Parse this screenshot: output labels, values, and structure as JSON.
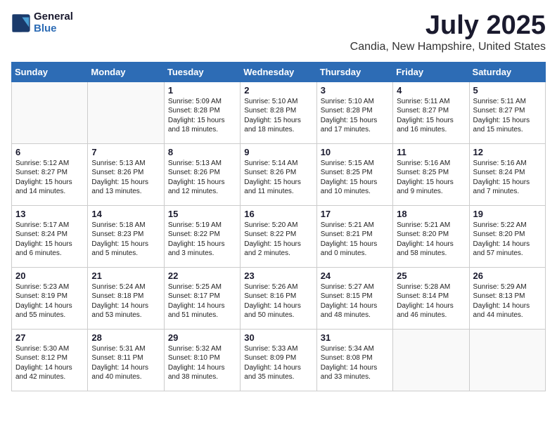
{
  "header": {
    "logo_line1": "General",
    "logo_line2": "Blue",
    "month": "July 2025",
    "location": "Candia, New Hampshire, United States"
  },
  "days_of_week": [
    "Sunday",
    "Monday",
    "Tuesday",
    "Wednesday",
    "Thursday",
    "Friday",
    "Saturday"
  ],
  "weeks": [
    [
      {
        "day": "",
        "info": ""
      },
      {
        "day": "",
        "info": ""
      },
      {
        "day": "1",
        "info": "Sunrise: 5:09 AM\nSunset: 8:28 PM\nDaylight: 15 hours\nand 18 minutes."
      },
      {
        "day": "2",
        "info": "Sunrise: 5:10 AM\nSunset: 8:28 PM\nDaylight: 15 hours\nand 18 minutes."
      },
      {
        "day": "3",
        "info": "Sunrise: 5:10 AM\nSunset: 8:28 PM\nDaylight: 15 hours\nand 17 minutes."
      },
      {
        "day": "4",
        "info": "Sunrise: 5:11 AM\nSunset: 8:27 PM\nDaylight: 15 hours\nand 16 minutes."
      },
      {
        "day": "5",
        "info": "Sunrise: 5:11 AM\nSunset: 8:27 PM\nDaylight: 15 hours\nand 15 minutes."
      }
    ],
    [
      {
        "day": "6",
        "info": "Sunrise: 5:12 AM\nSunset: 8:27 PM\nDaylight: 15 hours\nand 14 minutes."
      },
      {
        "day": "7",
        "info": "Sunrise: 5:13 AM\nSunset: 8:26 PM\nDaylight: 15 hours\nand 13 minutes."
      },
      {
        "day": "8",
        "info": "Sunrise: 5:13 AM\nSunset: 8:26 PM\nDaylight: 15 hours\nand 12 minutes."
      },
      {
        "day": "9",
        "info": "Sunrise: 5:14 AM\nSunset: 8:26 PM\nDaylight: 15 hours\nand 11 minutes."
      },
      {
        "day": "10",
        "info": "Sunrise: 5:15 AM\nSunset: 8:25 PM\nDaylight: 15 hours\nand 10 minutes."
      },
      {
        "day": "11",
        "info": "Sunrise: 5:16 AM\nSunset: 8:25 PM\nDaylight: 15 hours\nand 9 minutes."
      },
      {
        "day": "12",
        "info": "Sunrise: 5:16 AM\nSunset: 8:24 PM\nDaylight: 15 hours\nand 7 minutes."
      }
    ],
    [
      {
        "day": "13",
        "info": "Sunrise: 5:17 AM\nSunset: 8:24 PM\nDaylight: 15 hours\nand 6 minutes."
      },
      {
        "day": "14",
        "info": "Sunrise: 5:18 AM\nSunset: 8:23 PM\nDaylight: 15 hours\nand 5 minutes."
      },
      {
        "day": "15",
        "info": "Sunrise: 5:19 AM\nSunset: 8:22 PM\nDaylight: 15 hours\nand 3 minutes."
      },
      {
        "day": "16",
        "info": "Sunrise: 5:20 AM\nSunset: 8:22 PM\nDaylight: 15 hours\nand 2 minutes."
      },
      {
        "day": "17",
        "info": "Sunrise: 5:21 AM\nSunset: 8:21 PM\nDaylight: 15 hours\nand 0 minutes."
      },
      {
        "day": "18",
        "info": "Sunrise: 5:21 AM\nSunset: 8:20 PM\nDaylight: 14 hours\nand 58 minutes."
      },
      {
        "day": "19",
        "info": "Sunrise: 5:22 AM\nSunset: 8:20 PM\nDaylight: 14 hours\nand 57 minutes."
      }
    ],
    [
      {
        "day": "20",
        "info": "Sunrise: 5:23 AM\nSunset: 8:19 PM\nDaylight: 14 hours\nand 55 minutes."
      },
      {
        "day": "21",
        "info": "Sunrise: 5:24 AM\nSunset: 8:18 PM\nDaylight: 14 hours\nand 53 minutes."
      },
      {
        "day": "22",
        "info": "Sunrise: 5:25 AM\nSunset: 8:17 PM\nDaylight: 14 hours\nand 51 minutes."
      },
      {
        "day": "23",
        "info": "Sunrise: 5:26 AM\nSunset: 8:16 PM\nDaylight: 14 hours\nand 50 minutes."
      },
      {
        "day": "24",
        "info": "Sunrise: 5:27 AM\nSunset: 8:15 PM\nDaylight: 14 hours\nand 48 minutes."
      },
      {
        "day": "25",
        "info": "Sunrise: 5:28 AM\nSunset: 8:14 PM\nDaylight: 14 hours\nand 46 minutes."
      },
      {
        "day": "26",
        "info": "Sunrise: 5:29 AM\nSunset: 8:13 PM\nDaylight: 14 hours\nand 44 minutes."
      }
    ],
    [
      {
        "day": "27",
        "info": "Sunrise: 5:30 AM\nSunset: 8:12 PM\nDaylight: 14 hours\nand 42 minutes."
      },
      {
        "day": "28",
        "info": "Sunrise: 5:31 AM\nSunset: 8:11 PM\nDaylight: 14 hours\nand 40 minutes."
      },
      {
        "day": "29",
        "info": "Sunrise: 5:32 AM\nSunset: 8:10 PM\nDaylight: 14 hours\nand 38 minutes."
      },
      {
        "day": "30",
        "info": "Sunrise: 5:33 AM\nSunset: 8:09 PM\nDaylight: 14 hours\nand 35 minutes."
      },
      {
        "day": "31",
        "info": "Sunrise: 5:34 AM\nSunset: 8:08 PM\nDaylight: 14 hours\nand 33 minutes."
      },
      {
        "day": "",
        "info": ""
      },
      {
        "day": "",
        "info": ""
      }
    ]
  ]
}
